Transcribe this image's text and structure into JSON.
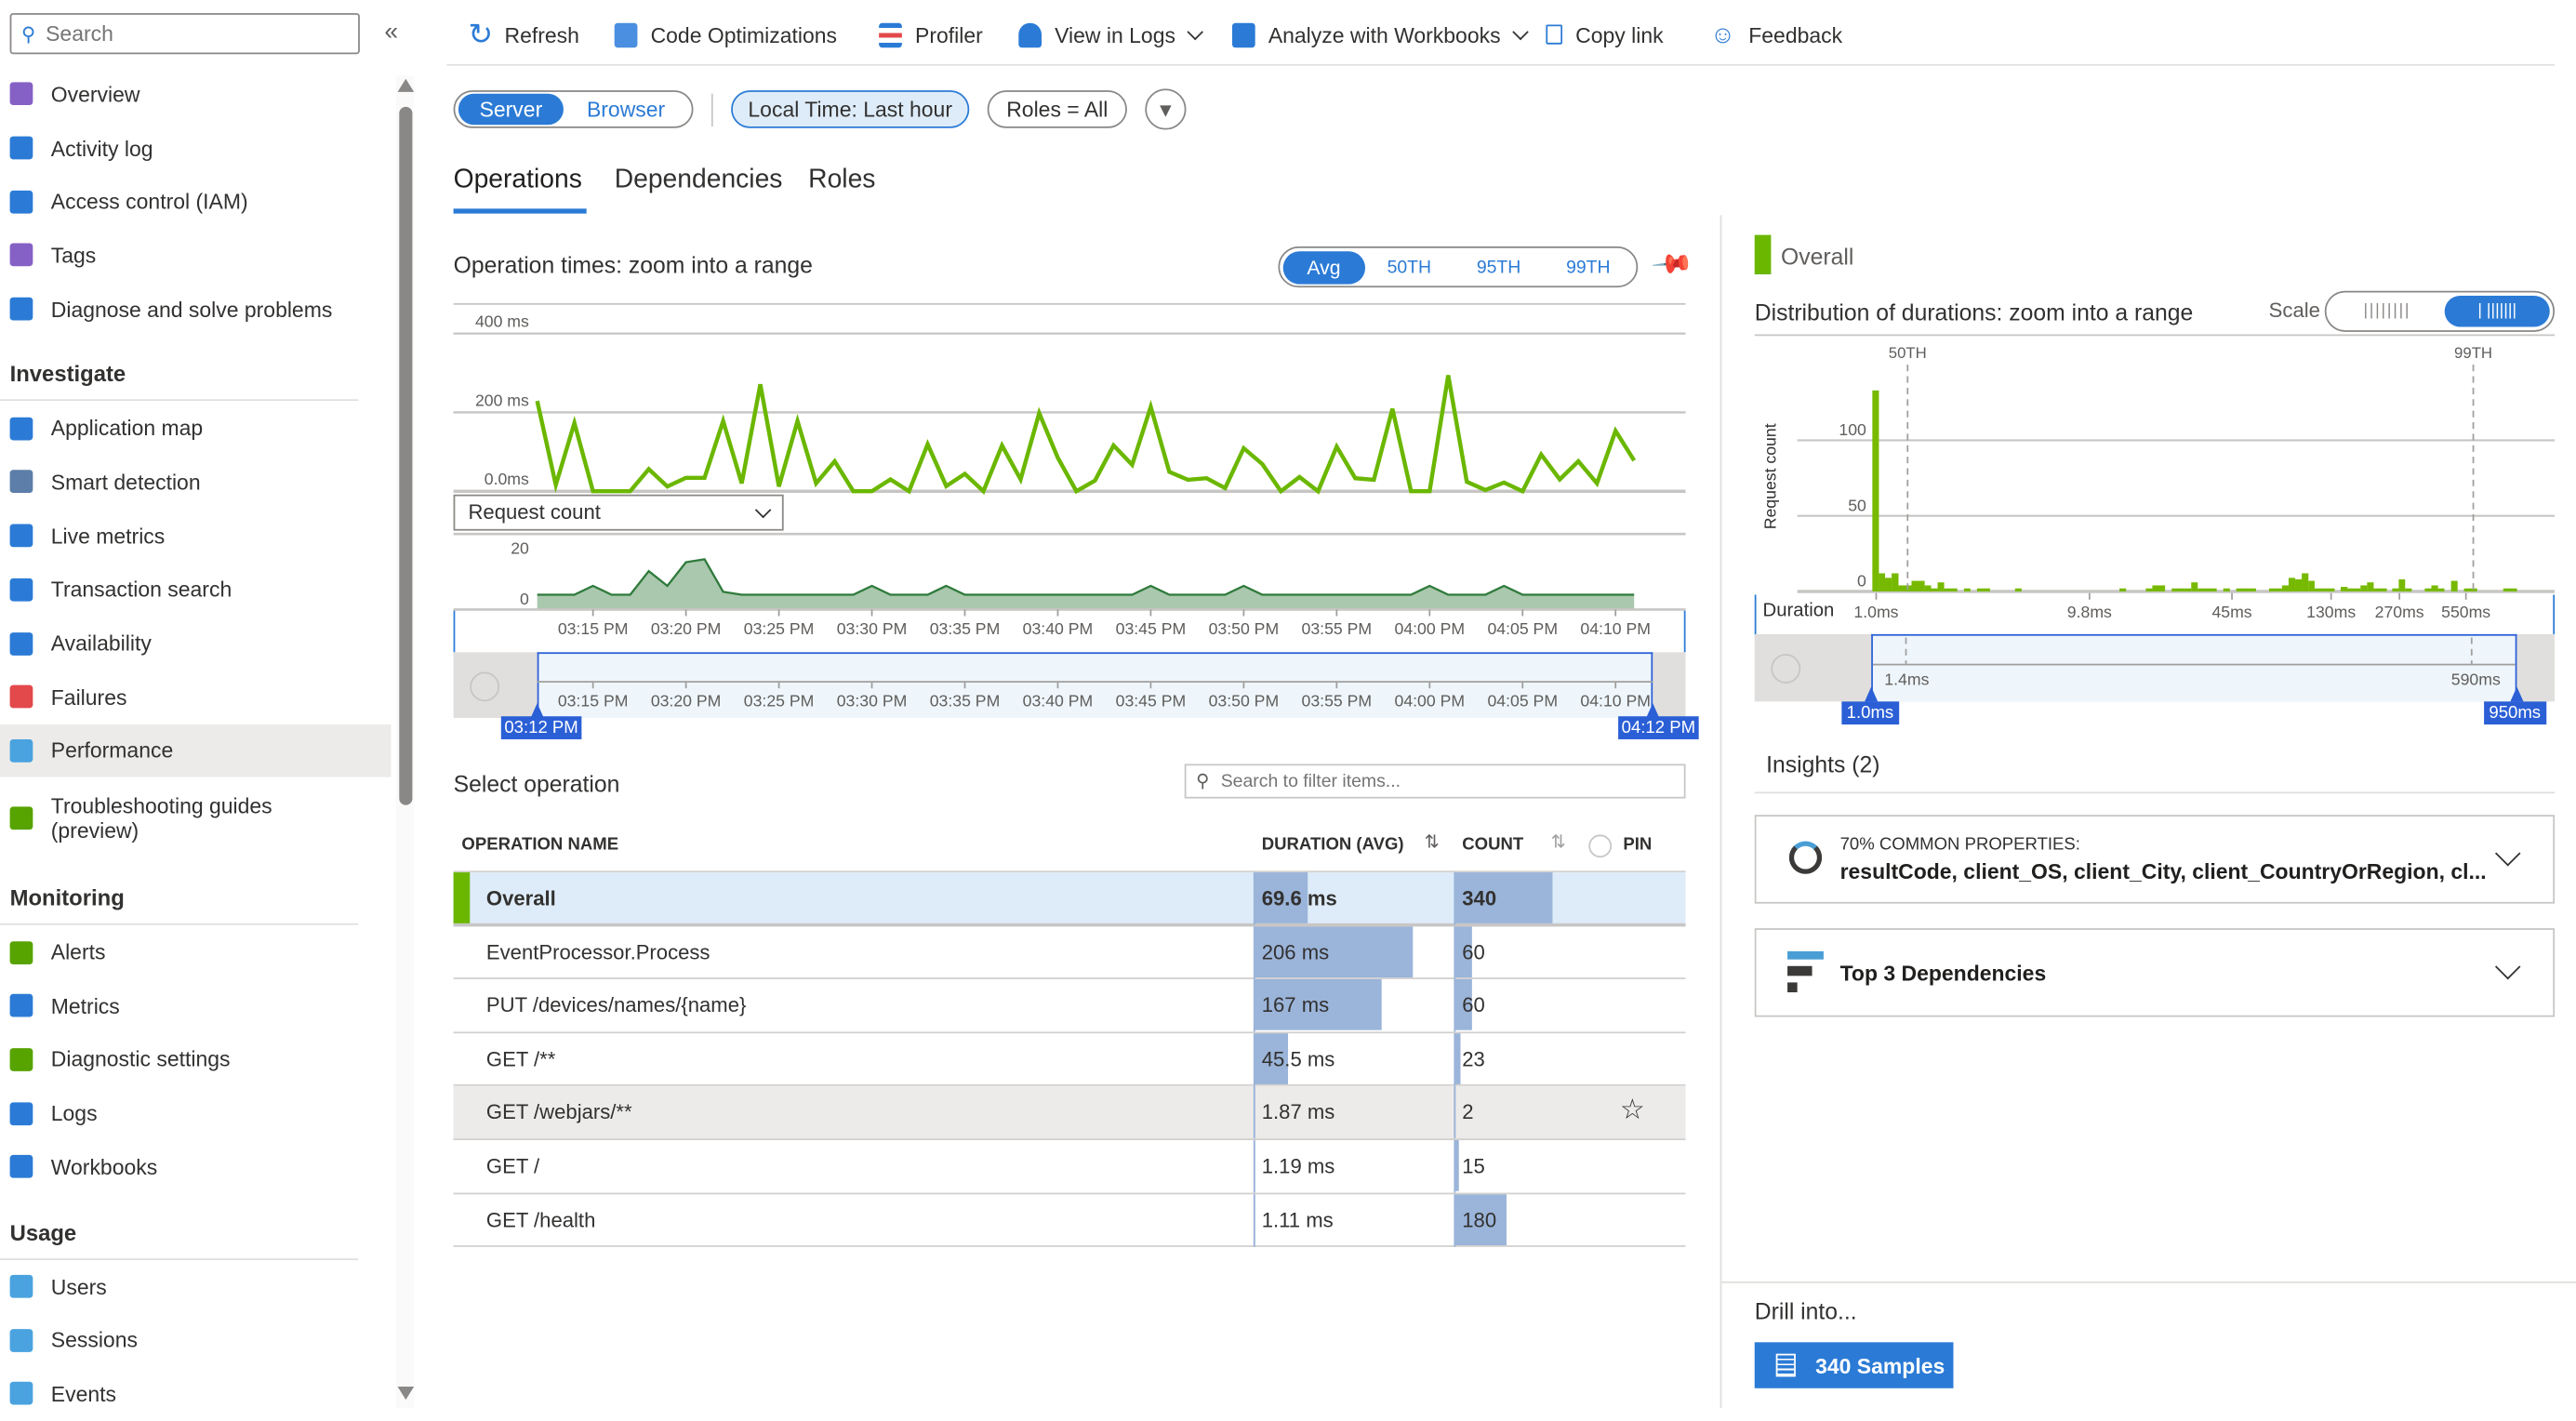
{
  "sidebar": {
    "search_placeholder": "Search",
    "collapse_label": "«",
    "sections": [
      {
        "header": "",
        "items": [
          {
            "label": "Overview",
            "icon": "lightbulb-icon",
            "color": "#8661c5"
          },
          {
            "label": "Activity log",
            "icon": "activity-log-icon",
            "color": "#2b7bd6"
          },
          {
            "label": "Access control (IAM)",
            "icon": "people-icon",
            "color": "#2b7bd6"
          },
          {
            "label": "Tags",
            "icon": "tag-icon",
            "color": "#8661c5"
          },
          {
            "label": "Diagnose and solve problems",
            "icon": "wrench-icon",
            "color": "#2b7bd6"
          }
        ]
      },
      {
        "header": "Investigate",
        "items": [
          {
            "label": "Application map",
            "icon": "app-map-icon",
            "color": "#2b7bd6"
          },
          {
            "label": "Smart detection",
            "icon": "smart-detection-icon",
            "color": "#5c7ea8"
          },
          {
            "label": "Live metrics",
            "icon": "pulse-icon",
            "color": "#2b7bd6"
          },
          {
            "label": "Transaction search",
            "icon": "search-icon",
            "color": "#2b7bd6"
          },
          {
            "label": "Availability",
            "icon": "globe-icon",
            "color": "#2b7bd6"
          },
          {
            "label": "Failures",
            "icon": "bar-chart-icon",
            "color": "#e3484b"
          },
          {
            "label": "Performance",
            "icon": "performance-icon",
            "color": "#4aa3df",
            "selected": true
          },
          {
            "label": "Troubleshooting guides (preview)",
            "icon": "guide-icon",
            "color": "#57a300",
            "two_line": true
          }
        ]
      },
      {
        "header": "Monitoring",
        "items": [
          {
            "label": "Alerts",
            "icon": "alert-icon",
            "color": "#57a300"
          },
          {
            "label": "Metrics",
            "icon": "metrics-icon",
            "color": "#2b7bd6"
          },
          {
            "label": "Diagnostic settings",
            "icon": "diagnostic-icon",
            "color": "#57a300"
          },
          {
            "label": "Logs",
            "icon": "logs-icon",
            "color": "#2b7bd6"
          },
          {
            "label": "Workbooks",
            "icon": "workbooks-icon",
            "color": "#2b7bd6"
          }
        ]
      },
      {
        "header": "Usage",
        "items": [
          {
            "label": "Users",
            "icon": "user-icon",
            "color": "#4aa3df"
          },
          {
            "label": "Sessions",
            "icon": "sessions-icon",
            "color": "#4aa3df"
          },
          {
            "label": "Events",
            "icon": "events-icon",
            "color": "#4aa3df"
          }
        ]
      }
    ]
  },
  "toolbar": {
    "refresh": "Refresh",
    "code_optimizations": "Code Optimizations",
    "profiler": "Profiler",
    "view_in_logs": "View in Logs",
    "analyze_workbooks": "Analyze with Workbooks",
    "copy_link": "Copy link",
    "feedback": "Feedback"
  },
  "filters": {
    "server": "Server",
    "browser": "Browser",
    "time_range": "Local Time: Last hour",
    "roles": "Roles = All"
  },
  "tabs": [
    "Operations",
    "Dependencies",
    "Roles"
  ],
  "operations": {
    "chart_title": "Operation times: zoom into a range",
    "percentiles": [
      "Avg",
      "50TH",
      "95TH",
      "99TH"
    ],
    "metric_select": "Request count",
    "brush_start": "03:12 PM",
    "brush_end": "04:12 PM",
    "select_title": "Select operation",
    "search_placeholder": "Search to filter items...",
    "columns": {
      "name": "OPERATION NAME",
      "duration": "DURATION (AVG)",
      "count": "COUNT",
      "pin": "PIN"
    },
    "rows": [
      {
        "name": "Overall",
        "duration": "69.6 ms",
        "duration_ms": 69.6,
        "count": "340",
        "count_n": 340,
        "overall": true
      },
      {
        "name": "EventProcessor.Process",
        "duration": "206 ms",
        "duration_ms": 206,
        "count": "60",
        "count_n": 60
      },
      {
        "name": "PUT /devices/names/{name}",
        "duration": "167 ms",
        "duration_ms": 167,
        "count": "60",
        "count_n": 60
      },
      {
        "name": "GET /**",
        "duration": "45.5 ms",
        "duration_ms": 45.5,
        "count": "23",
        "count_n": 23
      },
      {
        "name": "GET /webjars/**",
        "duration": "1.87 ms",
        "duration_ms": 1.87,
        "count": "2",
        "count_n": 2,
        "hovered": true
      },
      {
        "name": "GET /",
        "duration": "1.19 ms",
        "duration_ms": 1.19,
        "count": "15",
        "count_n": 15
      },
      {
        "name": "GET /health",
        "duration": "1.11 ms",
        "duration_ms": 1.11,
        "count": "180",
        "count_n": 180
      }
    ]
  },
  "right": {
    "overall_label": "Overall",
    "dist_title": "Distribution of durations: zoom into a range",
    "scale_label": "Scale",
    "brush_start": "1.0ms",
    "brush_end": "950ms",
    "brush_ticks": [
      "1.4ms",
      "590ms"
    ],
    "insights_title": "Insights (2)",
    "insight1_title": "70% COMMON PROPERTIES:",
    "insight1_body": "resultCode, client_OS, client_City, client_CountryOrRegion, cl...",
    "insight2_title": "Top 3 Dependencies",
    "drill_title": "Drill into...",
    "samples_button": "340 Samples"
  },
  "colors": {
    "accent": "#2b7bd6",
    "line": "#6bb700",
    "area_fill": "#a9c8ad",
    "area_line": "#2f7a3b",
    "bar": "#9bb4d9",
    "histogram": "#76b900"
  },
  "chart_data": [
    {
      "type": "line",
      "title": "Operation times: zoom into a range",
      "ylim": [
        0,
        400
      ],
      "y_ticks": [
        {
          "v": 400,
          "label": "400 ms"
        },
        {
          "v": 200,
          "label": "200 ms"
        },
        {
          "v": 0,
          "label": "0.0ms"
        }
      ],
      "x_domain": [
        "03:12 PM",
        "04:12 PM"
      ],
      "x": [
        "03:12 PM",
        "03:13 PM",
        "03:14 PM",
        "03:15 PM",
        "03:16 PM",
        "03:17 PM",
        "03:18 PM",
        "03:19 PM",
        "03:20 PM",
        "03:21 PM",
        "03:22 PM",
        "03:23 PM",
        "03:24 PM",
        "03:25 PM",
        "03:26 PM",
        "03:27 PM",
        "03:28 PM",
        "03:29 PM",
        "03:30 PM",
        "03:31 PM",
        "03:32 PM",
        "03:33 PM",
        "03:34 PM",
        "03:35 PM",
        "03:36 PM",
        "03:37 PM",
        "03:38 PM",
        "03:39 PM",
        "03:40 PM",
        "03:41 PM",
        "03:42 PM",
        "03:43 PM",
        "03:44 PM",
        "03:45 PM",
        "03:46 PM",
        "03:47 PM",
        "03:48 PM",
        "03:49 PM",
        "03:50 PM",
        "03:51 PM",
        "03:52 PM",
        "03:53 PM",
        "03:54 PM",
        "03:55 PM",
        "03:56 PM",
        "03:57 PM",
        "03:58 PM",
        "03:59 PM",
        "04:00 PM",
        "04:01 PM",
        "04:02 PM",
        "04:03 PM",
        "04:04 PM",
        "04:05 PM",
        "04:06 PM",
        "04:07 PM",
        "04:08 PM",
        "04:09 PM",
        "04:10 PM",
        "04:11 PM"
      ],
      "series": [
        {
          "values": [
            229,
            16,
            173,
            0,
            0,
            0,
            56,
            12,
            34,
            34,
            178,
            20,
            271,
            12,
            178,
            20,
            76,
            0,
            0,
            30,
            0,
            119,
            13,
            44,
            0,
            116,
            30,
            198,
            85,
            0,
            27,
            116,
            67,
            214,
            49,
            29,
            33,
            8,
            109,
            69,
            0,
            36,
            0,
            113,
            33,
            29,
            209,
            0,
            0,
            294,
            24,
            3,
            22,
            0,
            93,
            30,
            76,
            20,
            153,
            78
          ]
        }
      ],
      "grid": true
    },
    {
      "type": "area",
      "ylim": [
        0,
        20
      ],
      "y_ticks": [
        {
          "v": 20,
          "label": "20"
        },
        {
          "v": 0,
          "label": "0"
        }
      ],
      "series": [
        {
          "values": [
            5,
            5,
            5,
            8,
            5,
            5,
            13,
            8,
            16,
            17,
            6,
            5,
            5,
            5,
            5,
            5,
            5,
            5,
            8,
            5,
            5,
            5,
            8,
            5,
            5,
            5,
            5,
            5,
            5,
            5,
            5,
            5,
            5,
            8,
            5,
            5,
            5,
            5,
            8,
            5,
            5,
            5,
            5,
            5,
            5,
            5,
            5,
            5,
            8,
            5,
            5,
            5,
            8,
            5,
            5,
            5,
            5,
            5,
            5,
            5
          ]
        }
      ],
      "x_ticks": [
        "03:15 PM",
        "03:20 PM",
        "03:25 PM",
        "03:30 PM",
        "03:35 PM",
        "03:40 PM",
        "03:45 PM",
        "03:50 PM",
        "03:55 PM",
        "04:00 PM",
        "04:05 PM",
        "04:10 PM"
      ]
    },
    {
      "type": "bar",
      "title": "Distribution of durations: zoom into a range",
      "xlabel": "Duration",
      "ylabel": "Request count",
      "x_scale": "log",
      "x_ticks": [
        {
          "v": 1.0,
          "label": "1.0ms"
        },
        {
          "v": 9.8,
          "label": "9.8ms"
        },
        {
          "v": 45,
          "label": "45ms"
        },
        {
          "v": 130,
          "label": "130ms"
        },
        {
          "v": 270,
          "label": "270ms"
        },
        {
          "v": 550,
          "label": "550ms"
        }
      ],
      "y_ticks": [
        {
          "v": 100,
          "label": "100"
        },
        {
          "v": 50,
          "label": "50"
        },
        {
          "v": 0,
          "label": "0"
        }
      ],
      "percentiles": [
        {
          "label": "50TH",
          "ms": 1.4
        },
        {
          "label": "99TH",
          "ms": 595
        }
      ],
      "bins": [
        [
          0.96,
          1.03,
          133
        ],
        [
          1.03,
          1.1,
          12
        ],
        [
          1.1,
          1.18,
          9
        ],
        [
          1.18,
          1.27,
          12
        ],
        [
          1.27,
          1.46,
          4
        ],
        [
          1.46,
          1.68,
          7
        ],
        [
          1.68,
          1.8,
          4
        ],
        [
          1.8,
          1.93,
          2
        ],
        [
          1.93,
          2.07,
          6
        ],
        [
          2.07,
          2.38,
          2
        ],
        [
          2.56,
          2.74,
          2
        ],
        [
          2.94,
          3.38,
          2
        ],
        [
          4.42,
          4.74,
          2
        ],
        [
          13.5,
          14.5,
          2
        ],
        [
          17.9,
          19.2,
          2
        ],
        [
          19.2,
          22.0,
          4
        ],
        [
          23.6,
          27.1,
          2
        ],
        [
          27.1,
          29.1,
          2
        ],
        [
          29.1,
          31.2,
          6
        ],
        [
          31.2,
          38.2,
          2
        ],
        [
          41.0,
          44.0,
          2
        ],
        [
          47.1,
          58.2,
          2
        ],
        [
          66.9,
          76.9,
          2
        ],
        [
          76.9,
          82.5,
          4
        ],
        [
          82.5,
          88.5,
          9
        ],
        [
          88.5,
          94.9,
          8
        ],
        [
          94.9,
          102,
          12
        ],
        [
          102,
          109,
          7
        ],
        [
          109,
          135,
          2
        ],
        [
          144,
          155,
          3
        ],
        [
          155,
          178,
          2
        ],
        [
          178,
          191,
          4
        ],
        [
          191,
          205,
          6
        ],
        [
          205,
          236,
          2
        ],
        [
          250,
          268,
          2
        ],
        [
          268,
          287,
          8
        ],
        [
          287,
          308,
          2
        ],
        [
          354,
          380,
          2
        ],
        [
          380,
          408,
          4
        ],
        [
          408,
          437,
          2
        ],
        [
          469,
          503,
          7
        ],
        [
          539,
          620,
          2
        ],
        [
          820,
          950,
          2
        ]
      ]
    }
  ]
}
